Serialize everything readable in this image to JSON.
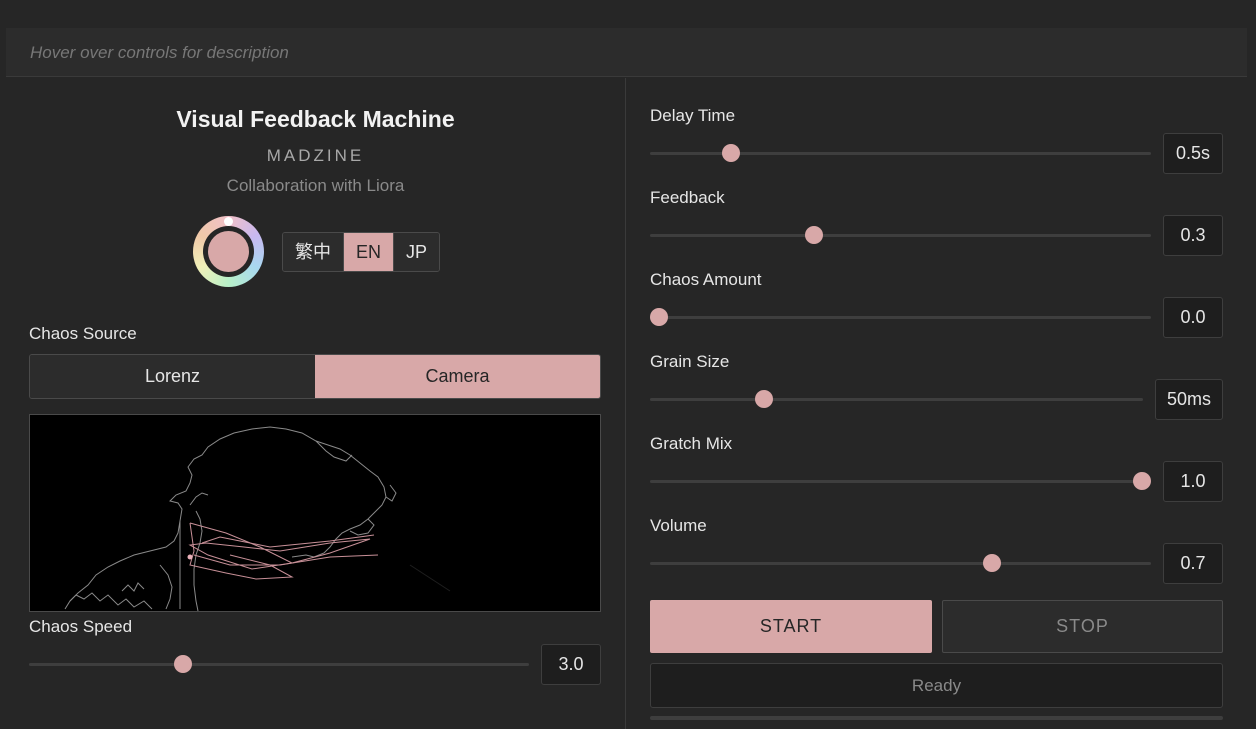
{
  "hint": {
    "text": "Hover over controls for description"
  },
  "header": {
    "title": "Visual Feedback Machine",
    "subtitle": "MADZINE",
    "collab": "Collaboration with Liora"
  },
  "language": {
    "options": [
      "繁中",
      "EN",
      "JP"
    ],
    "selected": "EN"
  },
  "chaos_source": {
    "label": "Chaos Source",
    "options": [
      "Lorenz",
      "Camera"
    ],
    "selected": "Camera"
  },
  "chaos_speed": {
    "label": "Chaos Speed",
    "value": "3.0",
    "fraction": 0.3
  },
  "controls": [
    {
      "label": "Delay Time",
      "value": "0.5s",
      "fraction": 0.15
    },
    {
      "label": "Feedback",
      "value": "0.3",
      "fraction": 0.32
    },
    {
      "label": "Chaos Amount",
      "value": "0.0",
      "fraction": 0.0
    },
    {
      "label": "Grain Size",
      "value": "50ms",
      "fraction": 0.22
    },
    {
      "label": "Gratch Mix",
      "value": "1.0",
      "fraction": 1.0
    },
    {
      "label": "Volume",
      "value": "0.7",
      "fraction": 0.69
    }
  ],
  "transport": {
    "start_label": "START",
    "stop_label": "STOP"
  },
  "status": {
    "text": "Ready"
  },
  "colors": {
    "accent": "#d8a8a8",
    "background": "#262626",
    "panel": "#2c2c2c"
  }
}
